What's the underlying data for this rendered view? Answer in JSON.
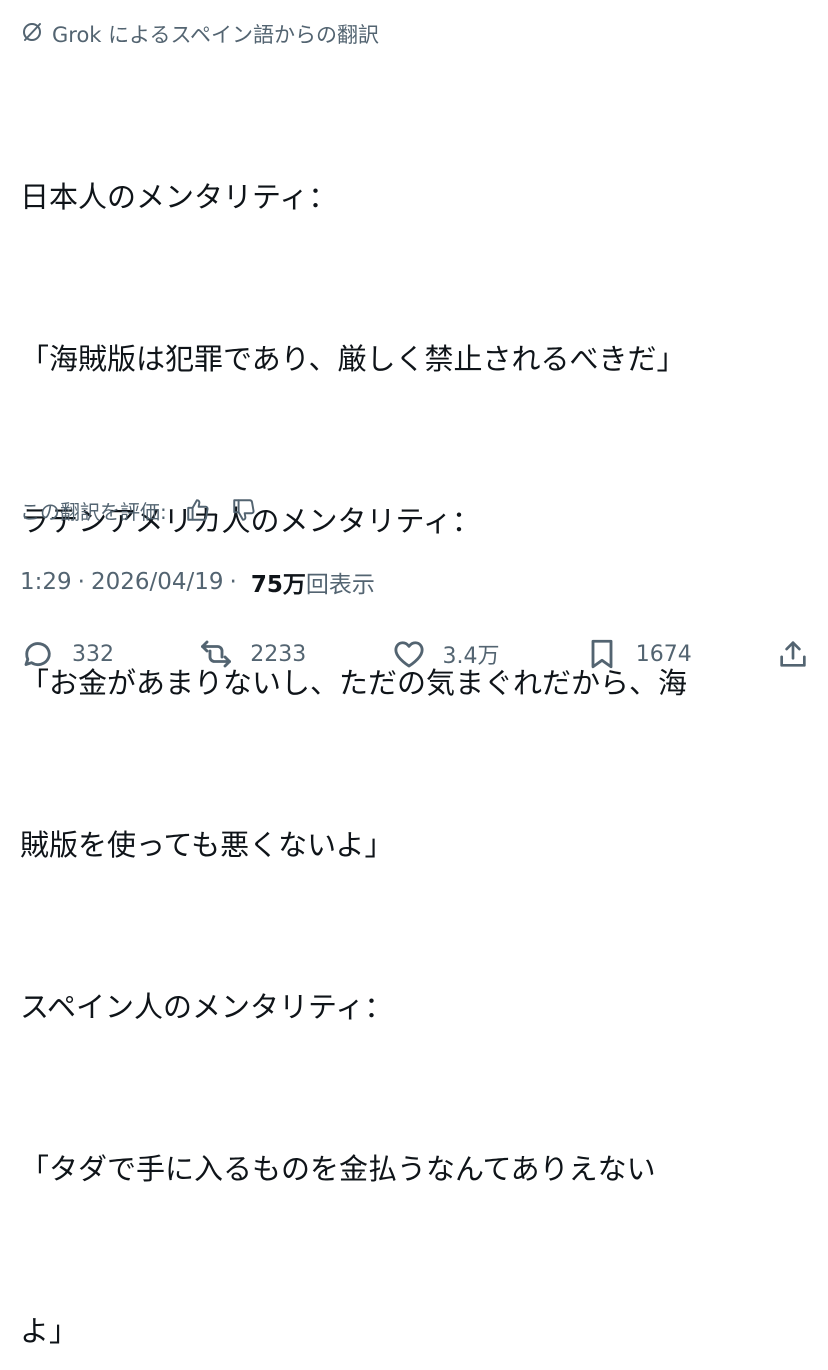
{
  "translation_note": "Grok によるスペイン語からの翻訳",
  "body_lines": [
    "日本人のメンタリティ：",
    "「海賊版は犯罪であり、厳しく禁止されるべきだ」",
    "ラテンアメリカ人のメンタリティ：",
    "「お金があまりないし、ただの気まぐれだから、海",
    "賊版を使っても悪くないよ」",
    "スペイン人のメンタリティ：",
    "「タダで手に入るものを金払うなんてありえない",
    "よ」"
  ],
  "rate_label": "この翻訳を評価:",
  "meta": {
    "time": "1:29",
    "date": "2026/04/19",
    "views_count": "75万",
    "views_label": "回表示",
    "separator": "·"
  },
  "actions": {
    "replies": "332",
    "reposts": "2233",
    "likes": "3.4万",
    "bookmarks": "1674"
  },
  "icons": {
    "grok": "grok-slash-circle-icon",
    "thumb_up": "thumb-up-icon",
    "thumb_down": "thumb-down-icon",
    "reply": "reply-bubble-icon",
    "repost": "repost-arrows-icon",
    "like": "heart-icon",
    "bookmark": "bookmark-icon",
    "share": "share-upload-icon"
  },
  "colors": {
    "text": "#0f1419",
    "muted": "#536471"
  }
}
